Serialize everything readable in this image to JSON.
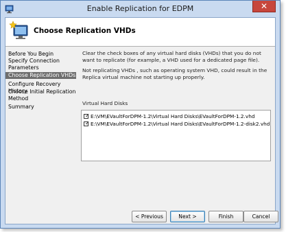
{
  "window": {
    "title": "Enable Replication for EDPM",
    "close_symbol": "✕"
  },
  "header": {
    "title": "Choose Replication VHDs"
  },
  "sidebar": {
    "items": [
      {
        "label": "Before You Begin",
        "active": false
      },
      {
        "label": "Specify Connection Parameters",
        "active": false
      },
      {
        "label": "Choose Replication VHDs",
        "active": true
      },
      {
        "label": "Configure Recovery History",
        "active": false
      },
      {
        "label": "Choose Initial Replication Method",
        "active": false
      },
      {
        "label": "Summary",
        "active": false
      }
    ]
  },
  "main": {
    "instruction": "Clear the check boxes of any virtual hard disks (VHDs) that you do not want to replicate (for example, a VHD used for a dedicated page file).",
    "warning": "Not replicating VHDs , such as operating system VHD, could result in the Replica virtual machine not starting up properly.",
    "vhd_list_label": "Virtual Hard Disks",
    "vhds": [
      {
        "path": "E:\\VM\\EVaultForDPM-1.2\\Virtual Hard Disks\\EVaultForDPM-1.2.vhd",
        "checked": true
      },
      {
        "path": "E:\\VM\\EVaultForDPM-1.2\\Virtual Hard Disks\\EVaultForDPM-1.2-disk2.vhd",
        "checked": true
      }
    ]
  },
  "buttons": {
    "previous": "< Previous",
    "next": "Next >",
    "finish": "Finish",
    "cancel": "Cancel"
  },
  "colors": {
    "titlebar": "#c9daf0",
    "close_button": "#c7463c",
    "active_step": "#6e6e6e"
  }
}
